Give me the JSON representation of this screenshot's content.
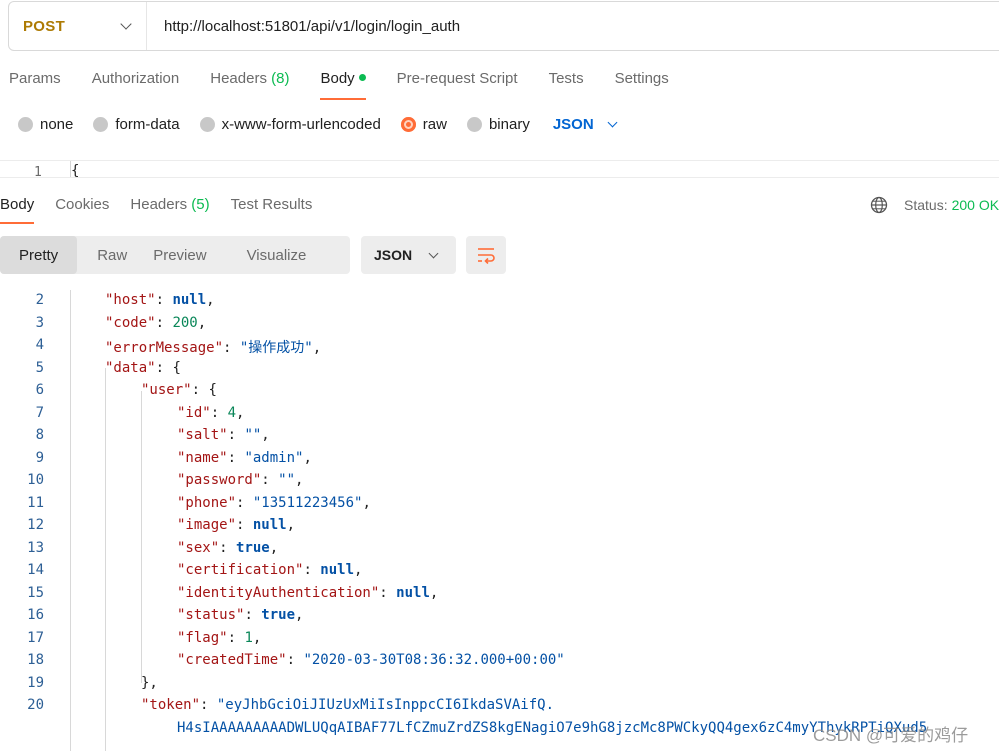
{
  "request": {
    "method": "POST",
    "url": "http://localhost:51801/api/v1/login/login_auth"
  },
  "request_tabs": {
    "params": "Params",
    "authorization": "Authorization",
    "headers": "Headers",
    "headers_count": "(8)",
    "body": "Body",
    "pre_request": "Pre-request Script",
    "tests": "Tests",
    "settings": "Settings"
  },
  "body_types": {
    "none": "none",
    "form_data": "form-data",
    "urlencoded": "x-www-form-urlencoded",
    "raw": "raw",
    "binary": "binary",
    "format": "JSON",
    "selected": "raw"
  },
  "request_editor": {
    "line_number": "1",
    "first_char": "{"
  },
  "response_tabs": {
    "body": "Body",
    "cookies": "Cookies",
    "headers": "Headers",
    "headers_count": "(5)",
    "test_results": "Test Results"
  },
  "status": {
    "label": "Status:",
    "value": "200 OK"
  },
  "view_modes": {
    "pretty": "Pretty",
    "raw": "Raw",
    "preview": "Preview",
    "visualize": "Visualize",
    "format": "JSON"
  },
  "response_lines": [
    {
      "n": "2",
      "indent": 0,
      "key": "\"host\"",
      "val": "null",
      "vt": "b",
      "tail": ","
    },
    {
      "n": "3",
      "indent": 0,
      "key": "\"code\"",
      "val": "200",
      "vt": "n",
      "tail": ","
    },
    {
      "n": "4",
      "indent": 0,
      "key": "\"errorMessage\"",
      "val": "\"操作成功\"",
      "vt": "s",
      "tail": ","
    },
    {
      "n": "5",
      "indent": 0,
      "key": "\"data\"",
      "val": "{",
      "vt": "p",
      "tail": ""
    },
    {
      "n": "6",
      "indent": 1,
      "key": "\"user\"",
      "val": "{",
      "vt": "p",
      "tail": ""
    },
    {
      "n": "7",
      "indent": 2,
      "key": "\"id\"",
      "val": "4",
      "vt": "n",
      "tail": ","
    },
    {
      "n": "8",
      "indent": 2,
      "key": "\"salt\"",
      "val": "\"\"",
      "vt": "s",
      "tail": ","
    },
    {
      "n": "9",
      "indent": 2,
      "key": "\"name\"",
      "val": "\"admin\"",
      "vt": "s",
      "tail": ","
    },
    {
      "n": "10",
      "indent": 2,
      "key": "\"password\"",
      "val": "\"\"",
      "vt": "s",
      "tail": ","
    },
    {
      "n": "11",
      "indent": 2,
      "key": "\"phone\"",
      "val": "\"13511223456\"",
      "vt": "s",
      "tail": ","
    },
    {
      "n": "12",
      "indent": 2,
      "key": "\"image\"",
      "val": "null",
      "vt": "b",
      "tail": ","
    },
    {
      "n": "13",
      "indent": 2,
      "key": "\"sex\"",
      "val": "true",
      "vt": "b",
      "tail": ","
    },
    {
      "n": "14",
      "indent": 2,
      "key": "\"certification\"",
      "val": "null",
      "vt": "b",
      "tail": ","
    },
    {
      "n": "15",
      "indent": 2,
      "key": "\"identityAuthentication\"",
      "val": "null",
      "vt": "b",
      "tail": ","
    },
    {
      "n": "16",
      "indent": 2,
      "key": "\"status\"",
      "val": "true",
      "vt": "b",
      "tail": ","
    },
    {
      "n": "17",
      "indent": 2,
      "key": "\"flag\"",
      "val": "1",
      "vt": "n",
      "tail": ","
    },
    {
      "n": "18",
      "indent": 2,
      "key": "\"createdTime\"",
      "val": "\"2020-03-30T08:36:32.000+00:00\"",
      "vt": "s",
      "tail": ""
    },
    {
      "n": "19",
      "indent": 1,
      "key": "",
      "val": "},",
      "vt": "p",
      "tail": ""
    },
    {
      "n": "20",
      "indent": 1,
      "key": "\"token\"",
      "val": "\"eyJhbGciOiJIUzUxMiIsInppcCI6IkdaSVAifQ.",
      "vt": "s",
      "tail": ""
    },
    {
      "n": "",
      "indent": 2,
      "key": "",
      "val": "H4sIAAAAAAAAADWLUQqAIBAF77LfCZmuZrdZS8kgENagiO7e9hG8jzcMc8PWCkyQQ4gex6zC4myYThykRPTiQXud5",
      "vt": "s",
      "tail": ""
    }
  ],
  "watermark": "CSDN @可爱的鸡仔"
}
